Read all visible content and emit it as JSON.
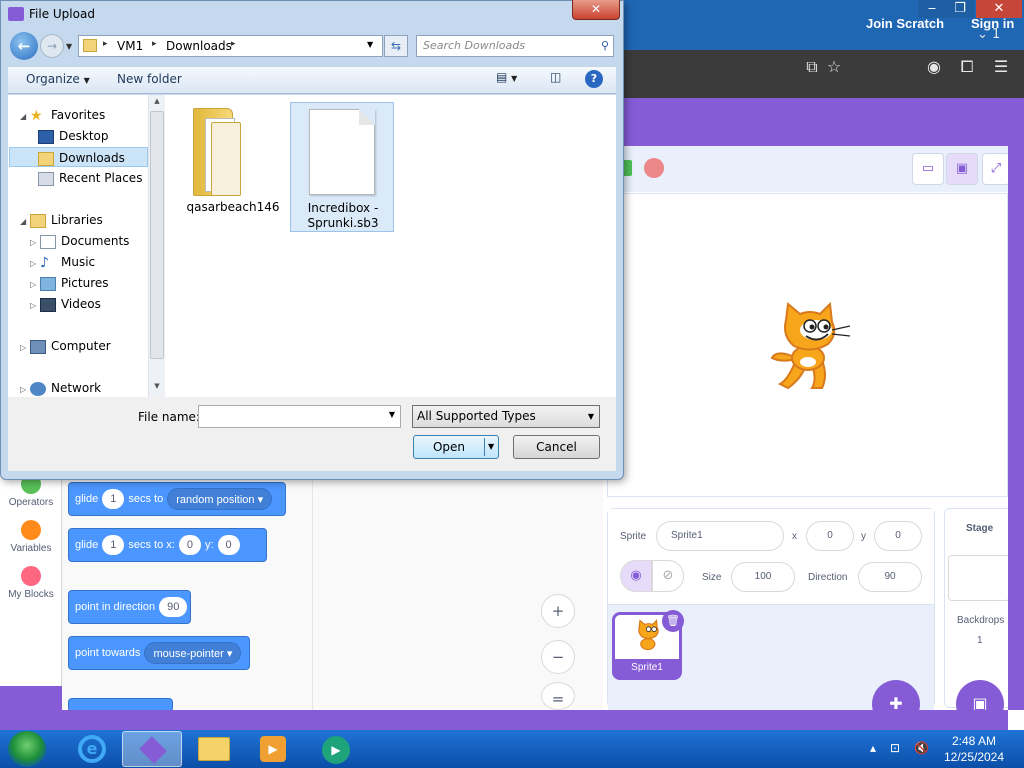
{
  "browser": {
    "tab_count": "1",
    "window_buttons": {
      "minimize": "‒",
      "restore": "❐",
      "close": "✕"
    }
  },
  "scratch": {
    "menu": {
      "join": "Join Scratch",
      "sign_in": "Sign in"
    },
    "sprite_info": {
      "sprite_label": "Sprite",
      "sprite_name": "Sprite1",
      "x_label": "x",
      "x_value": "0",
      "y_label": "y",
      "y_value": "0",
      "size_label": "Size",
      "size_value": "100",
      "direction_label": "Direction",
      "direction_value": "90"
    },
    "sprite_tile_label": "Sprite1",
    "stage_pane": {
      "title": "Stage",
      "backdrops_label": "Backdrops",
      "backdrops_count": "1"
    },
    "categories": [
      {
        "label": "Operators",
        "color": "#59c059"
      },
      {
        "label": "Variables",
        "color": "#ff8c1a"
      },
      {
        "label": "My Blocks",
        "color": "#ff6680"
      }
    ],
    "blocks": {
      "glide_random": {
        "a": "glide",
        "secs": "1",
        "b": "secs to",
        "target": "random position"
      },
      "glide_xy": {
        "a": "glide",
        "secs": "1",
        "b": "secs to x:",
        "x": "0",
        "c": "y:",
        "y": "0"
      },
      "point_direction": {
        "a": "point in direction",
        "value": "90"
      },
      "point_towards": {
        "a": "point towards",
        "target": "mouse-pointer"
      }
    },
    "zoom": {
      "in": "+",
      "out": "−",
      "reset": "="
    }
  },
  "dialog": {
    "title": "File Upload",
    "close": "✕",
    "address": {
      "root_sep": "▸",
      "crumbs": [
        "VM1",
        "Downloads"
      ]
    },
    "search_placeholder": "Search Downloads",
    "toolbar": {
      "organize": "Organize",
      "new_folder": "New folder"
    },
    "nav": {
      "favorites": "Favorites",
      "desktop": "Desktop",
      "downloads": "Downloads",
      "recent_places": "Recent Places",
      "libraries": "Libraries",
      "documents": "Documents",
      "music": "Music",
      "pictures": "Pictures",
      "videos": "Videos",
      "computer": "Computer",
      "network": "Network"
    },
    "files": [
      {
        "name": "qasarbeach146",
        "type": "folder"
      },
      {
        "name": "Incredibox -\nSprunki.sb3",
        "type": "file"
      }
    ],
    "file_name_label": "File name:",
    "file_name_value": "",
    "file_type": "All Supported Types",
    "open_label": "Open",
    "cancel_label": "Cancel"
  },
  "taskbar": {
    "time": "2:48 AM",
    "date": "12/25/2024"
  }
}
